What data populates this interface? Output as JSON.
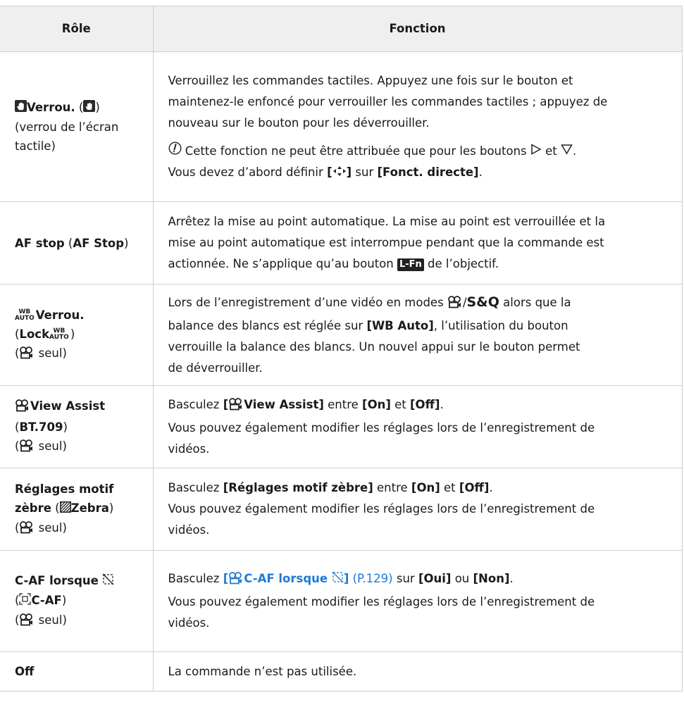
{
  "header": {
    "col1": "Rôle",
    "col2": "Fonction"
  },
  "rows": [
    {
      "role": {
        "main": "Verrou.",
        "open": " (",
        "close": ")",
        "sub1": "(verrou de l’écran",
        "sub2": "tactile)"
      },
      "func": {
        "line1": "Verrouillez les commandes tactiles. Appuyez une fois sur le bouton et",
        "line2": "maintenez-le enfoncé pour verrouiller les commandes tactiles ; appuyez de",
        "line3": "nouveau sur le bouton pour les déverrouiller.",
        "note1a": "Cette fonction ne peut être attribuée que pour les boutons",
        "note1b": "et",
        "note2a": "Vous devez d’abord définir",
        "note2b": "[",
        "note2c": "]",
        "note2d": " sur ",
        "note2e": "[Fonct. directe]",
        "note2f": "."
      }
    },
    {
      "role": {
        "main": "AF stop",
        "open": " (",
        "alt": "AF Stop",
        "close": ")"
      },
      "func": {
        "line1": "Arrêtez la mise au point automatique. La mise au point est verrouillée et la",
        "line2": "mise au point automatique est interrompue pendant que la commande est",
        "line3a": "actionnée. Ne s’applique qu’au bouton",
        "lfn": "L-Fn",
        "line3b": "de l’objectif."
      }
    },
    {
      "role": {
        "wb_top": "WB",
        "wb_bottom": "AUTO",
        "main": "Verrou.",
        "open": "(",
        "lock": "Lock",
        "close": ")",
        "only_open": "(",
        "only": " seul)"
      },
      "func": {
        "line1a": "Lors de l’enregistrement d’une vidéo en modes",
        "slash": "/",
        "sq": "S&Q",
        "line1b": "alors que la",
        "line2a": "balance des blancs est réglée sur ",
        "line2b": "[WB Auto]",
        "line2c": ", l’utilisation du bouton",
        "line3": "verrouille la balance des blancs. Un nouvel appui sur le bouton permet",
        "line4": "de déverrouiller."
      }
    },
    {
      "role": {
        "main": "View Assist",
        "open": "(",
        "alt": "BT.709",
        "close": ")",
        "only_open": "(",
        "only": " seul)"
      },
      "func": {
        "l1a": "Basculez ",
        "l1b": "[",
        "l1c": "View Assist]",
        "l1d": " entre ",
        "l1e": "[On]",
        "l1f": " et ",
        "l1g": "[Off]",
        "l1h": ".",
        "line2": "Vous pouvez également modifier les réglages lors de l’enregistrement de",
        "line3": "vidéos."
      }
    },
    {
      "role": {
        "main1": "Réglages motif",
        "main2": "zèbre",
        "open": " (",
        "alt": "Zebra",
        "close": ")",
        "only_open": "(",
        "only": " seul)"
      },
      "func": {
        "l1a": "Basculez ",
        "l1b": "[Réglages motif zèbre]",
        "l1c": " entre ",
        "l1d": "[On]",
        "l1e": " et ",
        "l1f": "[Off]",
        "l1g": ".",
        "line2": "Vous pouvez également modifier les réglages lors de l’enregistrement de",
        "line3": "vidéos."
      }
    },
    {
      "role": {
        "main": "C-AF lorsque",
        "open": "(",
        "alt": "C-AF",
        "close": ")",
        "only_open": "(",
        "only": " seul)"
      },
      "func": {
        "l1a": "Basculez ",
        "link1": "[",
        "link2": "C-AF lorsque",
        "link3": "]",
        "page": " (P.129)",
        "l1b": " sur ",
        "l1c": "[Oui]",
        "l1d": " ou ",
        "l1e": "[Non]",
        "l1f": ".",
        "line2": "Vous pouvez également modifier les réglages lors de l’enregistrement de",
        "line3": "vidéos."
      }
    },
    {
      "role": {
        "main": "Off"
      },
      "func": {
        "line1": "La commande n’est pas utilisée."
      }
    }
  ],
  "colors": {
    "link": "#1f7ad6",
    "header_bg": "#efefef",
    "border": "#cfcfcf"
  },
  "icons": [
    "touch-lock-icon",
    "caution-icon",
    "triangle-right-icon",
    "triangle-down-icon",
    "arrow-pad-icon",
    "movie-icon",
    "zebra-icon",
    "af-target-icon",
    "slash-circle-icon"
  ]
}
